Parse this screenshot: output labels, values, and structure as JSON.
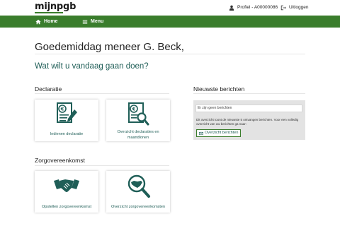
{
  "header": {
    "logo": "mijnpgb",
    "profile_label": "Profiel - A00000086",
    "logout_label": "Uitloggen"
  },
  "nav": {
    "home_label": "Home",
    "menu_label": "Menu"
  },
  "main": {
    "greeting": "Goedemiddag meneer G. Beck,",
    "question": "Wat wilt u vandaag gaan doen?"
  },
  "declaratie": {
    "title": "Declaratie",
    "cards": [
      {
        "label": "Indienen declaratie",
        "icon": "euro-document-pen-icon"
      },
      {
        "label": "Overzicht declaraties en maandlonen",
        "icon": "euro-document-search-icon"
      }
    ]
  },
  "zorgovereenkomst": {
    "title": "Zorgovereenkomst",
    "cards": [
      {
        "label": "Opstellen zorgovereenkomst",
        "icon": "handshake-icon"
      },
      {
        "label": "Overzicht zorgovereenkomsten",
        "icon": "handshake-search-icon"
      }
    ]
  },
  "messages": {
    "title": "Nieuwste berichten",
    "empty_text": "Er zijn geen berichten",
    "info": "Dit overzicht toont de nieuwste 5 ontvangen berichten. Voor een volledig overzicht van uw berichten ga naar:",
    "button_label": "Overzicht berichten"
  },
  "colors": {
    "brand_green": "#3a7d2c",
    "icon_teal": "#1f5e57"
  }
}
